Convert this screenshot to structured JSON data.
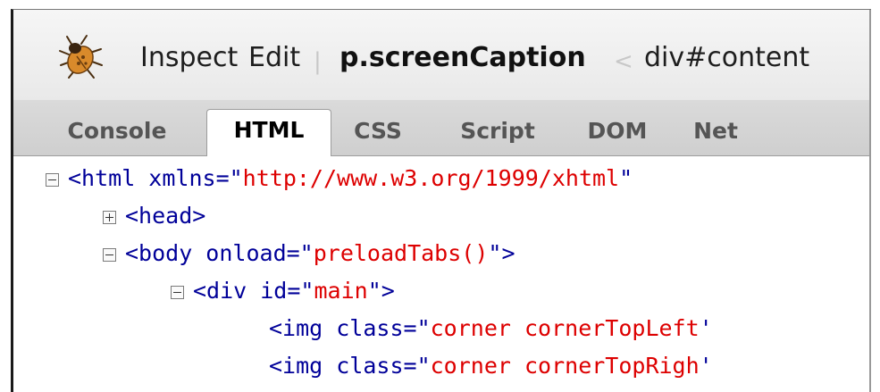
{
  "toolbar": {
    "inspect_label": "Inspect",
    "edit_label": "Edit",
    "separator": "|",
    "breadcrumb": {
      "current": "p.screenCaption",
      "arrow": "<",
      "parent": "div#content"
    },
    "logo_icon": "firebug-bug-icon"
  },
  "tabs": [
    {
      "label": "Console",
      "active": false
    },
    {
      "label": "HTML",
      "active": true
    },
    {
      "label": "CSS",
      "active": false
    },
    {
      "label": "Script",
      "active": false
    },
    {
      "label": "DOM",
      "active": false
    },
    {
      "label": "Net",
      "active": false
    }
  ],
  "code_lines": [
    {
      "toggle": "collapse",
      "pre": "<html xmlns=\"",
      "value": "http://www.w3.org/1999/xhtml",
      "post": "\""
    },
    {
      "toggle": "expand",
      "pre": "<head>",
      "value": "",
      "post": ""
    },
    {
      "toggle": "collapse",
      "pre": "<body onload=\"",
      "value": "preloadTabs()",
      "post": "\">"
    },
    {
      "toggle": "collapse",
      "pre": "<div id=\"",
      "value": "main",
      "post": "\">"
    },
    {
      "toggle": "none",
      "pre": "<img class=\"",
      "value": "corner cornerTopLeft",
      "post": "'"
    },
    {
      "toggle": "none",
      "pre": "<img class=\"",
      "value": "corner cornerTopRigh",
      "post": "'"
    }
  ],
  "colors": {
    "tag": "#000099",
    "attribute_value": "#dd0000",
    "toolbar_bg": "#eeeeee",
    "tabbar_bg": "#d4d4d4"
  }
}
